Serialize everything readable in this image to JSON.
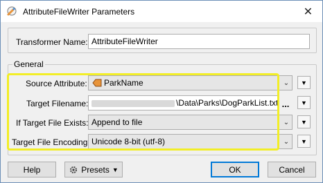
{
  "window": {
    "title": "AttributeFileWriter Parameters",
    "close_glyph": "✕"
  },
  "transformer_name": {
    "label": "Transformer Name:",
    "value": "AttributeFileWriter"
  },
  "general": {
    "legend": "General",
    "source_attribute": {
      "label": "Source Attribute:",
      "value": "ParkName"
    },
    "target_filename": {
      "label": "Target Filename:",
      "value": "\\Data\\Parks\\DogParkList.txt\"",
      "browse_label": "..."
    },
    "if_exists": {
      "label": "If Target File Exists:",
      "value": "Append to file"
    },
    "encoding": {
      "label": "Target File Encoding:",
      "value": "Unicode 8-bit (utf-8)"
    }
  },
  "buttons": {
    "help": "Help",
    "presets": "Presets",
    "ok": "OK",
    "cancel": "Cancel"
  },
  "icons": {
    "app": "wrench-gear-icon",
    "attribute": "attribute-tag-icon",
    "dropdown": "chevron-down-icon",
    "menu": "triangle-down-icon",
    "presets": "gear-icon"
  },
  "colors": {
    "highlight": "#f2ee26",
    "attribute_icon": "#e8943a",
    "default_button_border": "#0078d7"
  }
}
